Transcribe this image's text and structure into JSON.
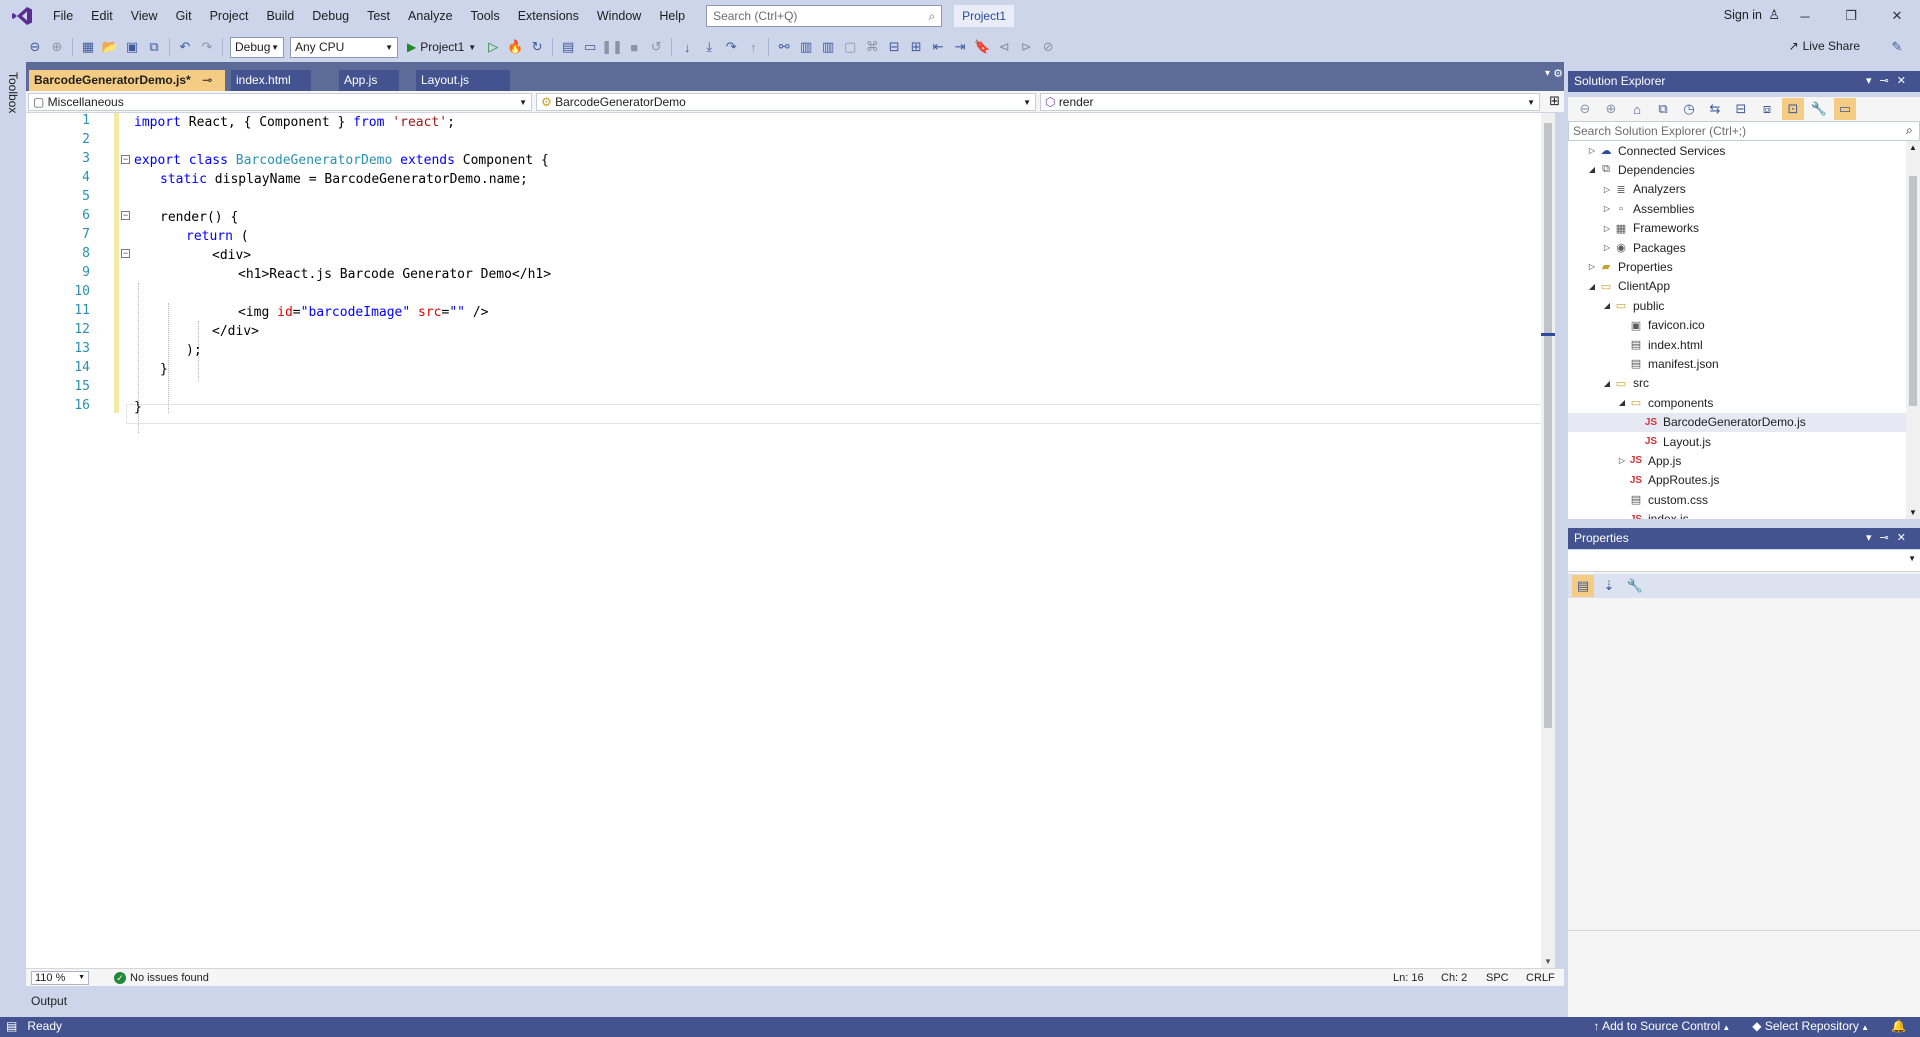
{
  "menu": [
    "File",
    "Edit",
    "View",
    "Git",
    "Project",
    "Build",
    "Debug",
    "Test",
    "Analyze",
    "Tools",
    "Extensions",
    "Window",
    "Help"
  ],
  "search": {
    "placeholder": "Search (Ctrl+Q)"
  },
  "project_name": "Project1",
  "account": {
    "signin_label": "Sign in"
  },
  "toolbar": {
    "config": "Debug",
    "platform": "Any CPU",
    "run_target": "Project1",
    "live_share": "Live Share"
  },
  "toolbox_label": "Toolbox",
  "tabs": [
    {
      "label": "BarcodeGeneratorDemo.js*",
      "active": true
    },
    {
      "label": "index.html",
      "active": false
    },
    {
      "label": "App.js",
      "active": false
    },
    {
      "label": "Layout.js",
      "active": false
    }
  ],
  "navbar": {
    "project": "Miscellaneous",
    "scope": "BarcodeGeneratorDemo",
    "member": "render"
  },
  "code": {
    "line_numbers": [
      "1",
      "2",
      "3",
      "4",
      "5",
      "6",
      "7",
      "8",
      "9",
      "10",
      "11",
      "12",
      "13",
      "14",
      "15",
      "16"
    ],
    "l1": {
      "kw_import": "import",
      "names": " React, { Component } ",
      "kw_from": "from",
      "sp": " ",
      "module": "'react'",
      "end": ";"
    },
    "l3": {
      "kw_export": "export",
      "kw_class": " class ",
      "cls": "BarcodeGeneratorDemo",
      "kw_extends": " extends ",
      "base": "Component",
      "brace": " {"
    },
    "l4": {
      "kw_static": "static",
      "rest": " displayName = BarcodeGeneratorDemo.name;"
    },
    "l6": {
      "text": "render() {"
    },
    "l7": {
      "kw_return": "return",
      "rest": " ("
    },
    "l8": {
      "text": "<div>"
    },
    "l9": {
      "text": "<h1>React.js Barcode Generator Demo</h1>"
    },
    "l11": {
      "tag_open": "<img ",
      "attr_id": "id",
      "eq1": "=",
      "val_id": "\"barcodeImage\"",
      "sp": " ",
      "attr_src": "src",
      "eq2": "=",
      "val_src": "\"\"",
      "tag_close": " />"
    },
    "l12": {
      "text": "</div>"
    },
    "l13": {
      "text": ");"
    },
    "l14": {
      "text": "}"
    },
    "l16": {
      "text": "}"
    }
  },
  "editor_status": {
    "zoom": "110 %",
    "issues": "No issues found",
    "line": "Ln: 16",
    "col": "Ch: 2",
    "spacing": "SPC",
    "eol": "CRLF"
  },
  "output_label": "Output",
  "solution_explorer": {
    "title": "Solution Explorer",
    "search_placeholder": "Search Solution Explorer (Ctrl+;)",
    "tree": [
      {
        "label": "Connected Services",
        "indent": 1,
        "arrow": "▷",
        "icon": "connected-services-icon",
        "glyph": "☁",
        "cls": "blue"
      },
      {
        "label": "Dependencies",
        "indent": 1,
        "arrow": "◢",
        "icon": "dependencies-icon",
        "glyph": "⧉",
        "cls": "file"
      },
      {
        "label": "Analyzers",
        "indent": 2,
        "arrow": "▷",
        "icon": "analyzers-icon",
        "glyph": "≣",
        "cls": "file"
      },
      {
        "label": "Assemblies",
        "indent": 2,
        "arrow": "▷",
        "icon": "assemblies-icon",
        "glyph": "▫",
        "cls": "file"
      },
      {
        "label": "Frameworks",
        "indent": 2,
        "arrow": "▷",
        "icon": "frameworks-icon",
        "glyph": "▦",
        "cls": "file"
      },
      {
        "label": "Packages",
        "indent": 2,
        "arrow": "▷",
        "icon": "packages-icon",
        "glyph": "◉",
        "cls": "file"
      },
      {
        "label": "Properties",
        "indent": 1,
        "arrow": "▷",
        "icon": "properties-folder-icon",
        "glyph": "▰",
        "cls": "folder"
      },
      {
        "label": "ClientApp",
        "indent": 1,
        "arrow": "◢",
        "icon": "folder-icon",
        "glyph": "▭",
        "cls": "folder"
      },
      {
        "label": "public",
        "indent": 2,
        "arrow": "◢",
        "icon": "folder-icon",
        "glyph": "▭",
        "cls": "folder"
      },
      {
        "label": "favicon.ico",
        "indent": 3,
        "arrow": "",
        "icon": "image-file-icon",
        "glyph": "▣",
        "cls": "file"
      },
      {
        "label": "index.html",
        "indent": 3,
        "arrow": "",
        "icon": "html-file-icon",
        "glyph": "▤",
        "cls": "file"
      },
      {
        "label": "manifest.json",
        "indent": 3,
        "arrow": "",
        "icon": "json-file-icon",
        "glyph": "▤",
        "cls": "file"
      },
      {
        "label": "src",
        "indent": 2,
        "arrow": "◢",
        "icon": "folder-icon",
        "glyph": "▭",
        "cls": "folder"
      },
      {
        "label": "components",
        "indent": 3,
        "arrow": "◢",
        "icon": "folder-icon",
        "glyph": "▭",
        "cls": "folder"
      },
      {
        "label": "BarcodeGeneratorDemo.js",
        "indent": 4,
        "arrow": "",
        "icon": "js-file-icon",
        "glyph": "JS",
        "cls": "js",
        "selected": true
      },
      {
        "label": "Layout.js",
        "indent": 4,
        "arrow": "",
        "icon": "js-file-icon",
        "glyph": "JS",
        "cls": "js"
      },
      {
        "label": "App.js",
        "indent": 3,
        "arrow": "▷",
        "icon": "js-file-icon",
        "glyph": "JS",
        "cls": "js",
        "arrow_indent": 3
      },
      {
        "label": "AppRoutes.js",
        "indent": 3,
        "arrow": "",
        "icon": "js-file-icon",
        "glyph": "JS",
        "cls": "js"
      },
      {
        "label": "custom.css",
        "indent": 3,
        "arrow": "",
        "icon": "css-file-icon",
        "glyph": "▤",
        "cls": "file"
      },
      {
        "label": "index.js",
        "indent": 3,
        "arrow": "",
        "icon": "js-file-icon",
        "glyph": "JS",
        "cls": "js"
      }
    ]
  },
  "properties": {
    "title": "Properties"
  },
  "statusbar": {
    "ready": "Ready",
    "source_control": "Add to Source Control",
    "repository": "Select Repository"
  }
}
